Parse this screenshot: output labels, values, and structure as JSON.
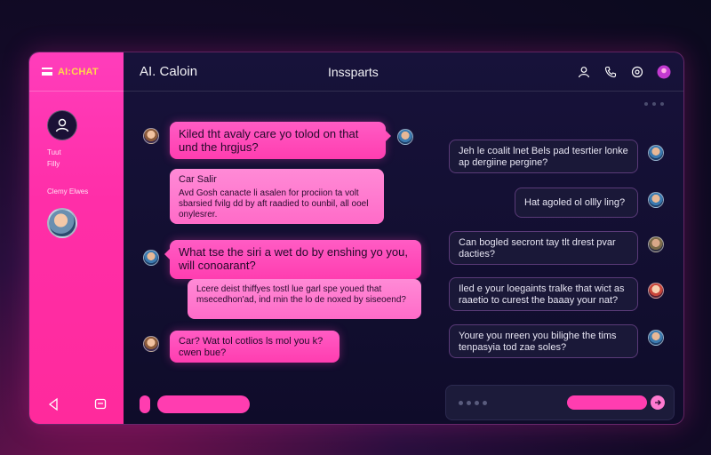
{
  "app": {
    "brand": "AI:CHAT",
    "header_title": "AI. Caloin",
    "header_center": "Inssparts"
  },
  "sidebar": {
    "user_line1": "Tuut",
    "user_line2": "Filly",
    "section_label": "Clemy Elwes"
  },
  "messages_left": [
    {
      "text": "Kiled tht avaly care yo tolod on that und the hrgjus?"
    },
    {
      "title": "Car Salir",
      "text": "Avd Gosh canacte li asalen for prociion ta volt sbarsied fvilg dd by aft raadied to ounbil, all ooel onylesrer."
    },
    {
      "text": "What tse the siri a wet do by enshing yo you, will conoarant?"
    },
    {
      "text": "Lcere deist thiffyes tostl lue garl spe youed that msecedhon'ad, ind rnin the lo de noxed by siseoend?"
    },
    {
      "text": "Car? Wat tol cotlios ls mol you k? cwen bue?"
    }
  ],
  "messages_right": [
    {
      "text": "Jeh le coalit lnet Bels pad tesrtier lonke ap dergiine pergine?"
    },
    {
      "text": "Hat agoled ol ollly ling?"
    },
    {
      "text": "Can bogled secront tay tlt drest pvar dacties?"
    },
    {
      "text": "Iled e your loegaints tralke that wict as raaetio to curest the baaay your nat?"
    },
    {
      "text": "Youre you nreen you bilighe the tims tenpasyia tod zae soles?"
    }
  ],
  "colors": {
    "accent": "#ff3db0",
    "brand": "#ffd84a",
    "background": "#0f0c2a"
  }
}
